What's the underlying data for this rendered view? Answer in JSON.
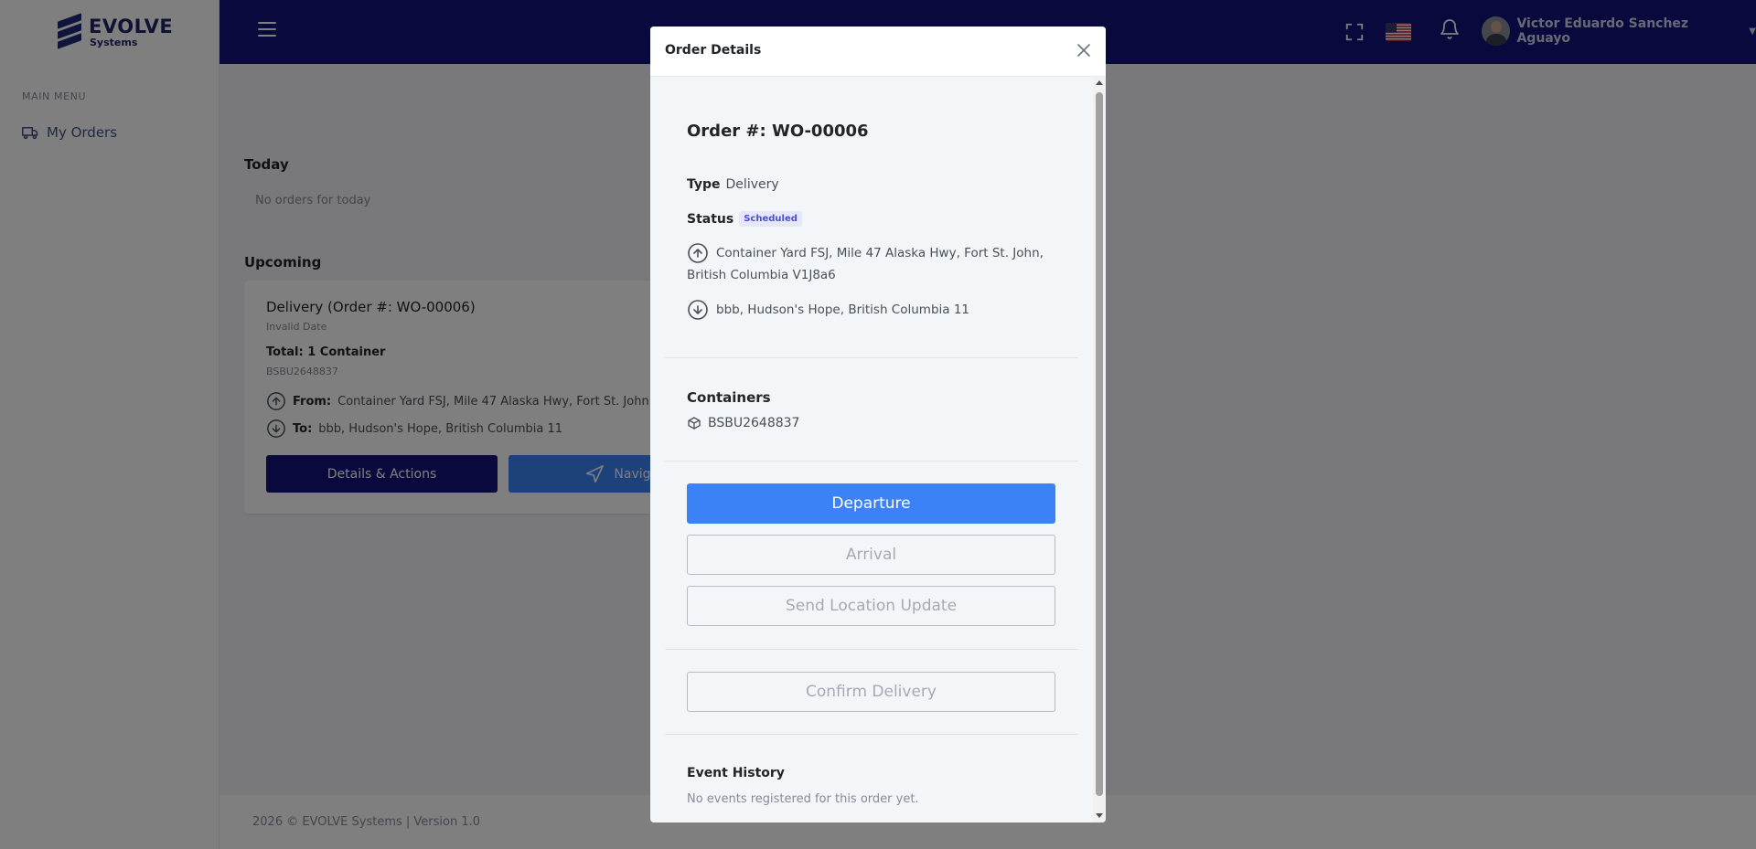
{
  "app": {
    "logo_title": "EVOLVE",
    "logo_subtitle": "Systems"
  },
  "sidebar": {
    "menu_title": "MAIN MENU",
    "items": [
      {
        "label": "My Orders",
        "icon": "truck-icon"
      }
    ]
  },
  "topbar": {
    "user_name": "Victor Eduardo Sanchez Aguayo",
    "language_flag": "us-flag"
  },
  "main": {
    "today": {
      "title": "Today",
      "empty_text": "No orders for today"
    },
    "upcoming": {
      "title": "Upcoming",
      "card": {
        "title": "Delivery (Order #: WO-00006)",
        "date": "Invalid Date",
        "total": "Total: 1 Container",
        "container": "BSBU2648837",
        "from_label": "From:",
        "from_value": "Container Yard FSJ, Mile 47 Alaska Hwy, Fort St. John, B",
        "to_label": "To:",
        "to_value": "bbb, Hudson's Hope, British Columbia 11",
        "details_button": "Details & Actions",
        "navigate_button": "Navigat"
      }
    }
  },
  "footer": {
    "text": "2026 © EVOLVE Systems | Version 1.0"
  },
  "modal": {
    "title": "Order Details",
    "order_number": "Order #: WO-00006",
    "type_label": "Type",
    "type_value": "Delivery",
    "status_label": "Status",
    "status_value": "Scheduled",
    "from_address": "Container Yard FSJ, Mile 47 Alaska Hwy, Fort St. John, British Columbia V1J8a6",
    "to_address": "bbb, Hudson's Hope, British Columbia 11",
    "containers_title": "Containers",
    "containers": [
      "BSBU2648837"
    ],
    "buttons": {
      "departure": "Departure",
      "arrival": "Arrival",
      "location_update": "Send Location Update",
      "confirm_delivery": "Confirm Delivery"
    },
    "history_title": "Event History",
    "history_empty": "No events registered for this order yet."
  },
  "colors": {
    "topbar": "#12127a",
    "primary": "#3b82f6",
    "dark_button": "#12127a",
    "badge_text": "#4b4fd1",
    "link": "#405189"
  }
}
